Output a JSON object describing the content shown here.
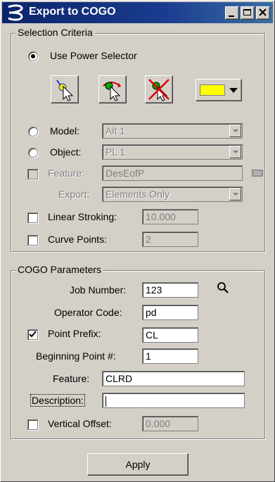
{
  "window": {
    "title": "Export to COGO"
  },
  "selection": {
    "group_title": "Selection Criteria",
    "use_power_selector": {
      "label": "Use Power Selector",
      "checked": true
    },
    "tools": [
      "select-element-tool-icon",
      "select-add-tool-icon",
      "deselect-tool-icon"
    ],
    "color_swatch": "#ffff00",
    "model": {
      "label": "Model:",
      "value": "Alt 1"
    },
    "object": {
      "label": "Object:",
      "value": "PL 1"
    },
    "feature": {
      "label": "Feature:",
      "value": "DesEofP"
    },
    "export": {
      "label": "Export:",
      "value": "Elements Only"
    },
    "linear_stroking": {
      "label": "Linear Stroking:",
      "value": "10.000"
    },
    "curve_points": {
      "label": "Curve Points:",
      "value": "2"
    }
  },
  "cogo": {
    "group_title": "COGO Parameters",
    "job_number": {
      "label": "Job Number:",
      "value": "123"
    },
    "operator_code": {
      "label": "Operator Code:",
      "value": "pd"
    },
    "point_prefix": {
      "label": "Point Prefix:",
      "value": "CL",
      "checked": true
    },
    "beginning_point": {
      "label": "Beginning Point #:",
      "value": "1"
    },
    "feature": {
      "label": "Feature:",
      "value": "CLRD"
    },
    "description": {
      "label": "Description:",
      "value": ""
    },
    "vertical_offset": {
      "label": "Vertical Offset:",
      "value": "0.000"
    }
  },
  "apply_label": "Apply"
}
